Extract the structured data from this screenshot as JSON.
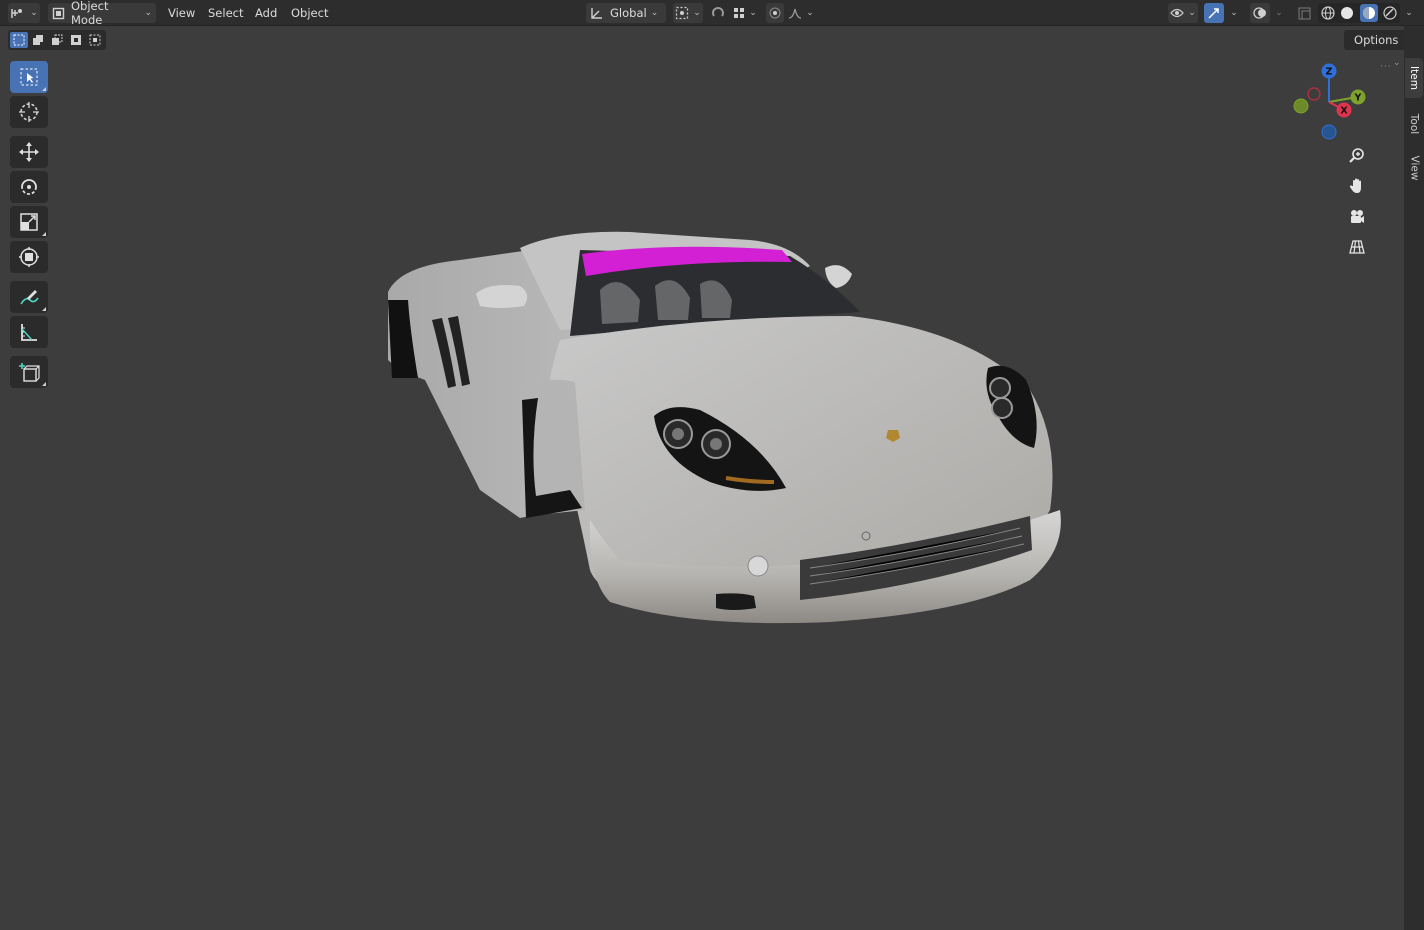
{
  "header": {
    "editor_type_icon": "editor-type-icon",
    "mode_label": "Object Mode",
    "menus": [
      "View",
      "Select",
      "Add",
      "Object"
    ],
    "transform_orientation": "Global",
    "pivot_icon": "pivot-point-icon",
    "snap_icon": "snap-magnet-icon",
    "proportional_icon": "proportional-editing-icon",
    "visibility_icon": "visibility-eye-icon",
    "gizmo_icon": "gizmo-toggle-icon",
    "overlay_icon": "overlay-icon",
    "xray_icon": "xray-icon",
    "shading_modes": [
      "wireframe",
      "solid",
      "material-preview",
      "rendered"
    ],
    "shading_active": "material-preview"
  },
  "viewport": {
    "select_modes": [
      "set",
      "extend",
      "subtract",
      "invert",
      "intersect"
    ],
    "options_label": "Options",
    "tools": [
      {
        "name": "select-box-tool",
        "icon": "select-box-icon",
        "active": true
      },
      {
        "name": "cursor-tool",
        "icon": "cursor-icon",
        "active": false
      },
      {
        "name": "move-tool",
        "icon": "move-icon",
        "active": false
      },
      {
        "name": "rotate-tool",
        "icon": "rotate-icon",
        "active": false
      },
      {
        "name": "scale-tool",
        "icon": "scale-icon",
        "active": false
      },
      {
        "name": "transform-tool",
        "icon": "transform-icon",
        "active": false
      },
      {
        "name": "annotate-tool",
        "icon": "annotate-icon",
        "active": false
      },
      {
        "name": "measure-tool",
        "icon": "measure-icon",
        "active": false
      },
      {
        "name": "add-cube-tool",
        "icon": "add-cube-icon",
        "active": false
      }
    ],
    "gizmo": {
      "z_label": "Z",
      "y_label": "Y",
      "x_label": "X",
      "z_color": "#2f6fdc",
      "y_color": "#7fa22c",
      "x_color": "#e0344e"
    },
    "nav_buttons": [
      "zoom-icon",
      "pan-hand-icon",
      "camera-icon",
      "ortho-grid-icon"
    ],
    "scene_object": "silver sports car 3D model"
  },
  "sidebar_tabs": [
    "Item",
    "Tool",
    "View"
  ],
  "colors": {
    "accent": "#4772b3",
    "header_bg": "#2d2d2d",
    "viewport_bg": "#3d3d3d",
    "highlight_magenta": "#d420d4"
  }
}
